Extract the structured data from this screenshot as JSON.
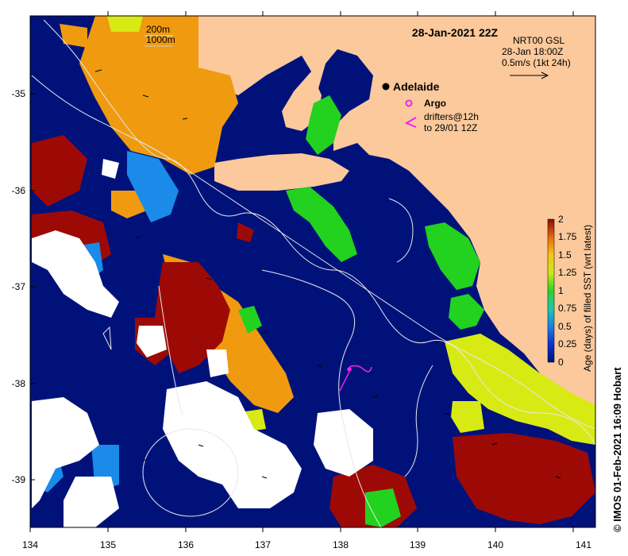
{
  "map": {
    "title": "28-Jan-2021 22Z",
    "bathy_legend": [
      "200m",
      "1000m"
    ],
    "current_info": {
      "line1": "NRT00 GSL",
      "line2": "28-Jan 18:00Z",
      "line3": "0.5m/s (1kt 24h)"
    },
    "city": {
      "name": "Adelaide",
      "lon": 138.6,
      "lat": -34.93
    },
    "argo_label": "Argo",
    "drifters_label_1": "drifters@12h",
    "drifters_label_2": "to 29/01 12Z",
    "credit": "© IMOS 01-Feb-2021 16:09 Hobart",
    "x_ticks": [
      "134",
      "135",
      "136",
      "137",
      "138",
      "139",
      "140",
      "141"
    ],
    "y_ticks": [
      "-35",
      "-36",
      "-37",
      "-38",
      "-39"
    ],
    "colors": {
      "land": "#fbc99b",
      "ocean": "#00127a",
      "age_0": "#00127a",
      "age_0_5": "#19b5e8",
      "age_1": "#22d21f",
      "age_1_5": "#f09a10",
      "age_2": "#9d0a05",
      "no_data": "#ffffff",
      "argo": "#ee22ee"
    }
  },
  "colorbar": {
    "label": "Age (days) of filled SST (wrt latest)",
    "ticks": [
      "2",
      "1.75",
      "1.5",
      "1.25",
      "1",
      "0.75",
      "0.5",
      "0.25",
      "0"
    ]
  }
}
